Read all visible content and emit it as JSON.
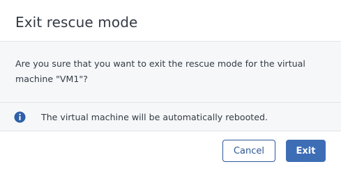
{
  "dialog": {
    "title": "Exit rescue mode",
    "message": "Are you sure that you want to exit the rescue mode for the virtual machine \"VM1\"?",
    "info": {
      "icon": "info-icon",
      "text": "The virtual machine will be automatically rebooted."
    },
    "buttons": {
      "cancel_label": "Cancel",
      "exit_label": "Exit"
    }
  },
  "colors": {
    "primary": "#3d6db5",
    "info_icon": "#2f5fa8",
    "body_background": "#f5f7f9"
  }
}
